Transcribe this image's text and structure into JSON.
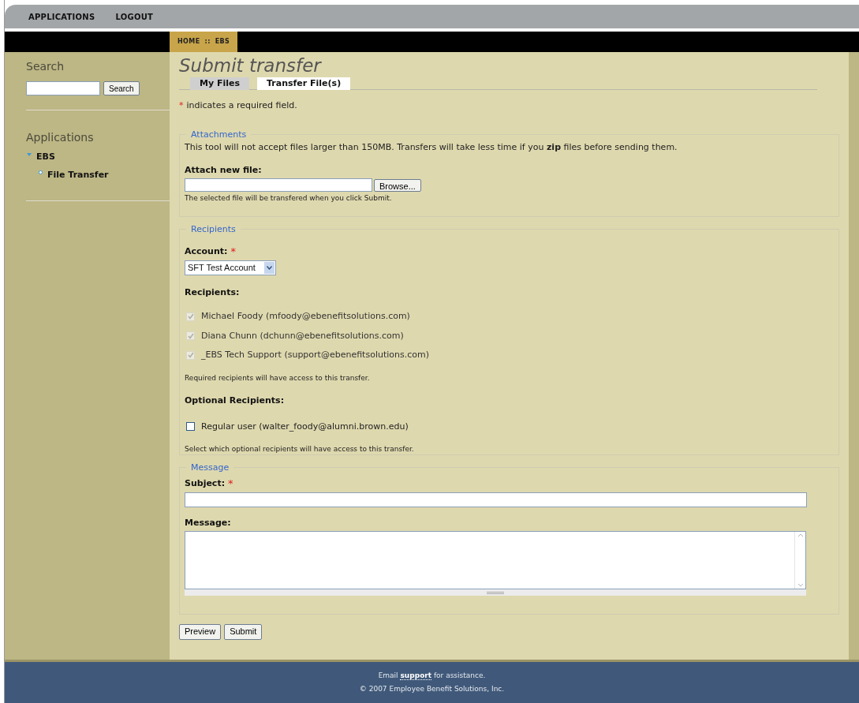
{
  "top_nav": [
    {
      "label": "APPLICATIONS"
    },
    {
      "label": "LOGOUT"
    }
  ],
  "breadcrumb": {
    "items": [
      "HOME",
      "EBS"
    ],
    "separator": "::"
  },
  "sidebar": {
    "search_title": "Search",
    "search_button": "Search",
    "applications_title": "Applications",
    "tree": [
      {
        "label": "EBS",
        "expanded": true,
        "children": [
          {
            "label": "File Transfer"
          }
        ]
      }
    ]
  },
  "page_title": "Submit transfer",
  "tabs": [
    {
      "label": "My Files",
      "selected": false
    },
    {
      "label": "Transfer File(s)",
      "selected": true
    }
  ],
  "required_note": {
    "mark": "*",
    "text": "indicates a required field."
  },
  "attachments": {
    "legend": "Attachments",
    "info": "This tool will not accept files larger than 150MB. Transfers will take less time if you **zip** files before sending them.",
    "label": "Attach new file:",
    "browse_button": "Browse...",
    "hint": "The selected file will be transfered when you click Submit."
  },
  "recipients": {
    "legend": "Recipients",
    "account_label": "Account:",
    "account_required": true,
    "account_value": "SFT Test Account",
    "recipients_label": "Recipients:",
    "required_list": [
      {
        "label": "Michael Foody (mfoody@ebenefitsolutions.com)",
        "checked": true,
        "disabled": true
      },
      {
        "label": "Diana Chunn (dchunn@ebenefitsolutions.com)",
        "checked": true,
        "disabled": true
      },
      {
        "label": "_EBS Tech Support (support@ebenefitsolutions.com)",
        "checked": true,
        "disabled": true
      }
    ],
    "required_hint": "Required recipients will have access to this transfer.",
    "optional_label": "Optional Recipients:",
    "optional_list": [
      {
        "label": "Regular user (walter_foody@alumni.brown.edu)",
        "checked": false,
        "disabled": false
      }
    ],
    "optional_hint": "Select which optional recipients will have access to this transfer."
  },
  "message": {
    "legend": "Message",
    "subject_label": "Subject:",
    "subject_required": true,
    "message_label": "Message:"
  },
  "buttons": [
    "Preview",
    "Submit"
  ],
  "footer": {
    "before": "Email",
    "link": "support",
    "after": "for assistance.",
    "copyright": "© 2007 Employee Benefit Solutions, Inc."
  }
}
